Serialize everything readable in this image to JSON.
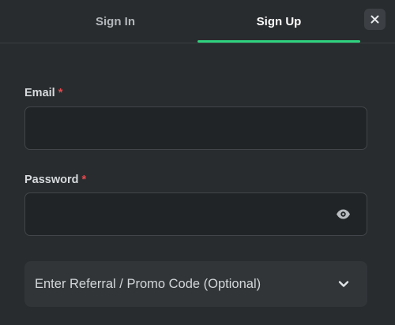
{
  "tabs": {
    "sign_in": "Sign In",
    "sign_up": "Sign Up"
  },
  "icons": {
    "close": "close-icon",
    "show_password": "eye-icon",
    "expand": "chevron-down-icon"
  },
  "form": {
    "email": {
      "label": "Email",
      "required_mark": "*",
      "value": ""
    },
    "password": {
      "label": "Password",
      "required_mark": "*",
      "value": ""
    },
    "promo": {
      "label": "Enter Referral / Promo Code (Optional)"
    }
  },
  "colors": {
    "background": "#292c2e",
    "accent": "#2fd37f",
    "required": "#e8474d",
    "input_background": "#212426"
  }
}
